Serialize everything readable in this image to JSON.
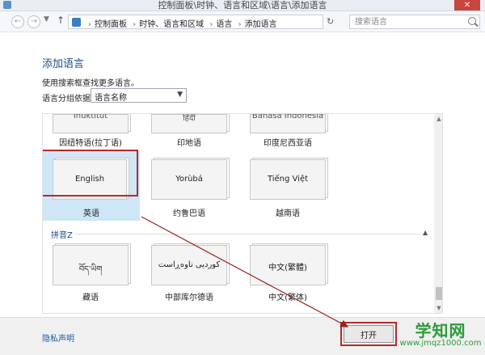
{
  "window": {
    "title": "控制面板\\时钟、语言和区域\\语言\\添加语言",
    "close": "✕"
  },
  "address": {
    "crumbs": [
      "控制面板",
      "时钟、语言和区域",
      "语言",
      "添加语言"
    ],
    "search_placeholder": "搜索语言"
  },
  "page": {
    "title": "添加语言",
    "instruction": "使用搜索框查找更多语言。",
    "group_label": "语言分组依据:",
    "group_value": "语言名称"
  },
  "languages_top": [
    {
      "native": "Inuktitut",
      "name": "因纽特语(拉丁语)"
    },
    {
      "native": "हिंदी",
      "name": "印地语"
    },
    {
      "native": "Bahasa Indonesia",
      "name": "印度尼西亚语"
    }
  ],
  "languages_mid": [
    {
      "native": "English",
      "name": "英语"
    },
    {
      "native": "Yorùbá",
      "name": "约鲁巴语"
    },
    {
      "native": "Tiếng Việt",
      "name": "越南语"
    }
  ],
  "group_header": "拼音Z",
  "languages_bottom": [
    {
      "native": "བོད་ཡིག",
      "name": "藏语"
    },
    {
      "native": "کوردیی ناوەڕاست",
      "name": "中部库尔德语"
    },
    {
      "native": "中文(繁體)",
      "name": "中文(繁体)"
    }
  ],
  "footer": {
    "privacy": "隐私声明",
    "open": "打开"
  },
  "watermark": {
    "big": "学知网",
    "small": "www.jmqz1000.com"
  },
  "colors": {
    "highlight_red": "#b52a2a",
    "selection_blue": "#cfe6f7",
    "title_blue": "#1e4b8c"
  }
}
